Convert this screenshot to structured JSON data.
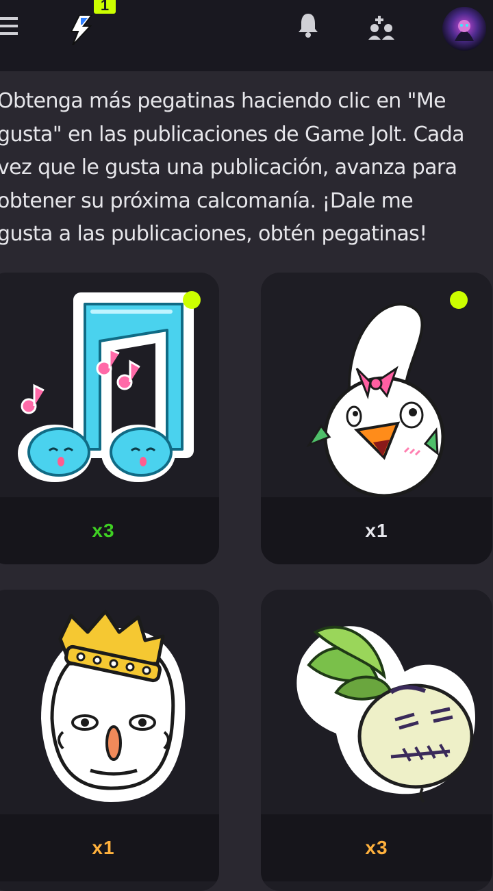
{
  "header": {
    "menu_icon": "hamburger-menu-icon",
    "logo_icon": "game-jolt-bolt-icon",
    "badge_count": "1",
    "notifications_icon": "bell-icon",
    "add_friends_icon": "add-user-icon",
    "avatar_icon": "avatar"
  },
  "intro": {
    "text": "Obtenga más pegatinas haciendo clic en \"Me\ngusta\" en las publicaciones de Game Jolt. Cada\nvez que le gusta una publicación, avanza para\nobtener su próxima calcomanía. ¡Dale me\ngusta a las publicaciones, obtén pegatinas!"
  },
  "stickers": [
    {
      "name": "music-notes",
      "count": "x3",
      "count_color": "#3fd023",
      "new": true
    },
    {
      "name": "chicken-girl",
      "count": "x1",
      "count_color": "#e8e8ee",
      "new": true
    },
    {
      "name": "crowned-guy",
      "count": "x1",
      "count_color": "#ffb13d",
      "new": false
    },
    {
      "name": "turnip",
      "count": "x3",
      "count_color": "#ffb13d",
      "new": false
    }
  ],
  "colors": {
    "accent": "#ccff00",
    "topbar": "#191820",
    "background": "#2a2830"
  }
}
